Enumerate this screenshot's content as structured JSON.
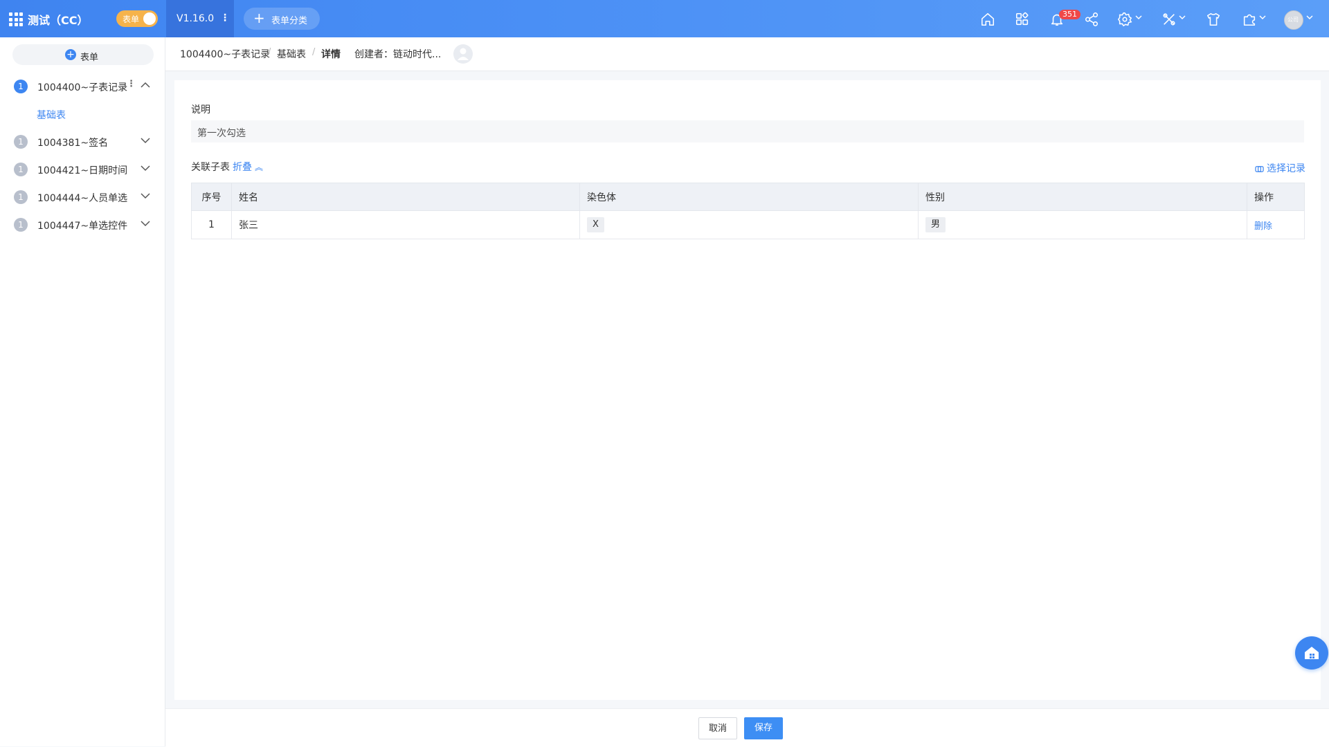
{
  "topbar": {
    "app_title": "测试（CC）",
    "mode_toggle_label": "表单",
    "version": "V1.16.0",
    "category_button": "表单分类",
    "notification_count": "351",
    "avatar_text": "公司"
  },
  "sidebar": {
    "add_form_label": "表单",
    "items": [
      {
        "num": "1",
        "label": "1004400~子表记录",
        "expanded": true
      },
      {
        "num": "1",
        "label": "1004381~签名"
      },
      {
        "num": "1",
        "label": "1004421~日期时间"
      },
      {
        "num": "1",
        "label": "1004444~人员单选"
      },
      {
        "num": "1",
        "label": "1004447~单选控件"
      }
    ],
    "sub_item": "基础表"
  },
  "breadcrumb": {
    "items": [
      "1004400~子表记录",
      "基础表",
      "详情"
    ],
    "creator_label": "创建者：",
    "creator_name": "链动时代..."
  },
  "form": {
    "description_label": "说明",
    "description_value": "第一次勾选",
    "subtable_label": "关联子表",
    "collapse_label": "折叠",
    "select_records_label": "选择记录",
    "table": {
      "headers": [
        "序号",
        "姓名",
        "染色体",
        "性别",
        "操作"
      ],
      "rows": [
        {
          "index": "1",
          "name": "张三",
          "chromosome": "X",
          "gender": "男",
          "action": "删除"
        }
      ]
    }
  },
  "footer": {
    "cancel_label": "取消",
    "save_label": "保存"
  },
  "colors": {
    "primary": "#3d86f1",
    "toggle": "#f6b34b",
    "badge": "#f04848"
  }
}
